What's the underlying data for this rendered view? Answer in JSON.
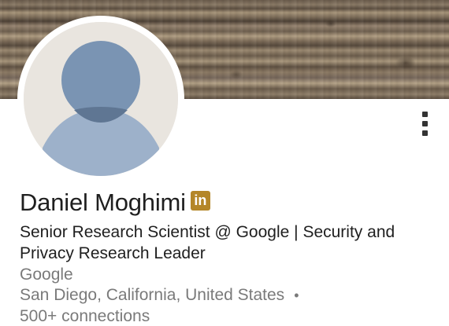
{
  "profile": {
    "name": "Daniel Moghimi",
    "badge_icon": "linkedin-icon",
    "badge_text": "in",
    "headline": "Senior Research Scientist @ Google | Security and Privacy Research Leader",
    "company": "Google",
    "location": "San Diego, California, United States",
    "separator": "•",
    "connections": "500+ connections"
  },
  "menu": {
    "icon": "more-vertical-icon"
  },
  "colors": {
    "badge": "#b48628",
    "avatar_background": "#e9e5df",
    "avatar_silhouette": "#8ea4c0",
    "secondary_text": "#7a7a7a"
  }
}
